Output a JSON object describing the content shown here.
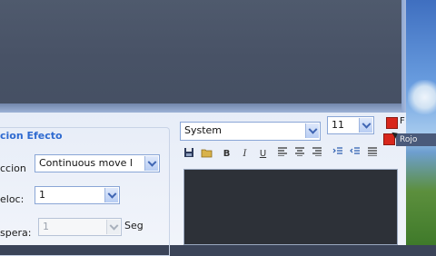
{
  "window": {
    "group_title": "cion Efecto"
  },
  "effect": {
    "action_label": "ccion",
    "action_value": "Continuous move l",
    "speed_label": "eloc:",
    "speed_value": "1",
    "wait_label": "spera:",
    "wait_value": "1",
    "wait_unit": "Seg"
  },
  "font": {
    "family_value": "System",
    "size_value": "11"
  },
  "toolbar": {
    "bold": "B",
    "italic": "I",
    "underline": "U",
    "icons": [
      "save-icon",
      "open-folder-icon",
      "bold-icon",
      "italic-icon",
      "underline-icon",
      "align-left-icon",
      "align-center-icon",
      "align-right-icon",
      "align-justify-icon",
      "indent-icon",
      "outdent-icon"
    ]
  },
  "color": {
    "tooltip": "Rojo",
    "swatch": "#d8271c",
    "label_fragment": "F"
  }
}
